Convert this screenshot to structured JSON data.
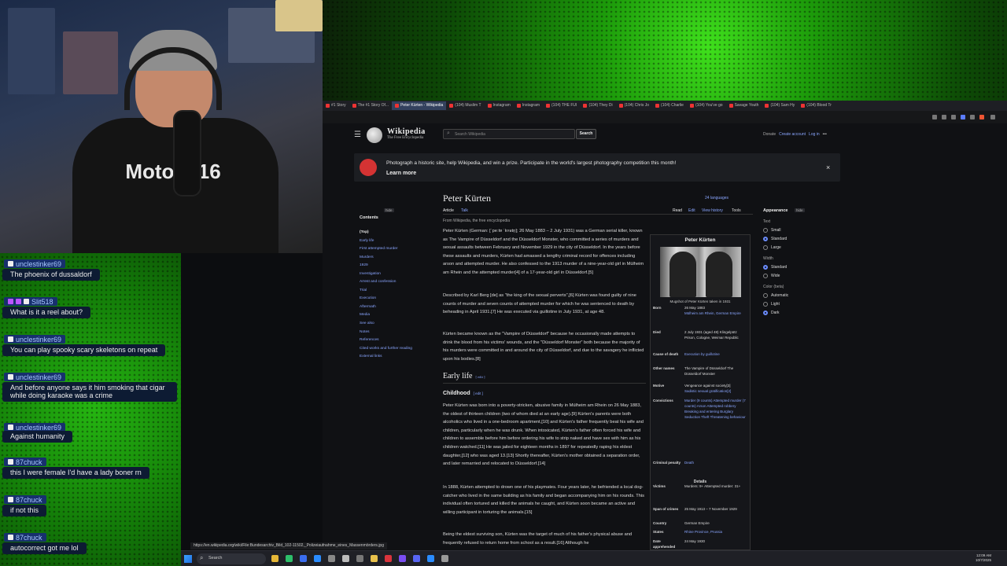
{
  "browser": {
    "tabs": [
      {
        "label": "#1 Story",
        "active": false
      },
      {
        "label": "The #1 Story Of...",
        "active": false
      },
      {
        "label": "Peter Kürten - Wikipedia",
        "active": true
      },
      {
        "label": "(104) Muslim T",
        "active": false
      },
      {
        "label": "Instagram",
        "active": false
      },
      {
        "label": "Instagram",
        "active": false
      },
      {
        "label": "(104) THE FUI",
        "active": false
      },
      {
        "label": "(104) They Di",
        "active": false
      },
      {
        "label": "(104) Chris Jo",
        "active": false
      },
      {
        "label": "(104) Charlie",
        "active": false
      },
      {
        "label": "(104) You've go",
        "active": false
      },
      {
        "label": "Savage Youth",
        "active": false
      },
      {
        "label": "(104) Sam Hy",
        "active": false
      },
      {
        "label": "(104) Blood Tr",
        "active": false
      }
    ],
    "status_url": "https://en.wikipedia.org/wiki/File:Bundesarchiv_Bild_102-11502,_Polizeiaufnahme_eines_Massenmörders.jpg"
  },
  "wikipedia": {
    "wordmark": "Wikipedia",
    "tagline": "The Free Encyclopedia",
    "search_placeholder": "Search Wikipedia",
    "search_button": "Search",
    "user_links": [
      "Donate",
      "Create account",
      "Log in",
      "•••"
    ],
    "banner": {
      "text": "Photograph a historic site, help Wikipedia, and win a prize. Participate in the world's largest photography competition this month!",
      "learn_more": "Learn more",
      "close": "×"
    },
    "toc": {
      "title": "Contents",
      "hide": "hide",
      "items": [
        "(Top)",
        "Early life",
        "First attempted murder",
        "Murders",
        "1929",
        "Investigation",
        "Arrest and confession",
        "Trial",
        "Execution",
        "Aftermath",
        "Media",
        "See also",
        "Notes",
        "References",
        "Cited works and further reading",
        "External links"
      ]
    },
    "article": {
      "title": "Peter Kürten",
      "languages": "24 languages",
      "tabs": {
        "article": "Article",
        "talk": "Talk",
        "read": "Read",
        "edit": "Edit",
        "history": "View history",
        "tools": "Tools"
      },
      "from": "From Wikipedia, the free encyclopedia",
      "p1": "Peter Kürten (German: [ˈpeːtɐ ˈkʏʁtn̩]; 26 May 1883 – 2 July 1931) was a German serial killer, known as The Vampire of Düsseldorf and the Düsseldorf Monster, who committed a series of murders and sexual assaults between February and November 1929 in the city of Düsseldorf. In the years before these assaults and murders, Kürten had amassed a lengthy criminal record for offences including arson and attempted murder. He also confessed to the 1913 murder of a nine-year-old girl in Mülheim am Rhein and the attempted murder[4] of a 17-year-old girl in Düsseldorf.[5]",
      "p2": "Described by Karl Berg [de] as \"the king of the sexual perverts\",[6] Kürten was found guilty of nine counts of murder and seven counts of attempted murder for which he was sentenced to death by beheading in April 1931.[7] He was executed via guillotine in July 1931, at age 48.",
      "p3": "Kürten became known as the \"Vampire of Düsseldorf\" because he occasionally made attempts to drink the blood from his victims' wounds, and the \"Düsseldorf Monster\" both because the majority of his murders were committed in and around the city of Düsseldorf, and due to the savagery he inflicted upon his bodies.[8]",
      "h_early": "Early life",
      "h_child": "Childhood",
      "edit": "[ edit ]",
      "p4": "Peter Kürten was born into a poverty-stricken, abusive family in Mülheim am Rhein on 26 May 1883, the oldest of thirteen children (two of whom died at an early age).[9] Kürten's parents were both alcoholics who lived in a one-bedroom apartment,[10] and Kürten's father frequently beat his wife and children, particularly when he was drunk. When intoxicated, Kürten's father often forced his wife and children to assemble before him before ordering his wife to strip naked and have sex with him as his children watched.[11] He was jailed for eighteen months in 1897 for repeatedly raping his eldest daughter,[12] who was aged 13.[13] Shortly thereafter, Kürten's mother obtained a separation order, and later remarried and relocated to Düsseldorf.[14]",
      "p5": "In 1888, Kürten attempted to drown one of his playmates. Four years later, he befriended a local dog-catcher who lived in the same building as his family and began accompanying him on his rounds. This individual often tortured and killed the animals he caught, and Kürten soon became an active and willing participant in torturing the animals.[15]",
      "p6": "Being the eldest surviving son, Kürten was the target of much of his father's physical abuse and frequently refused to return home from school as a result.[16] Although he"
    },
    "infobox": {
      "title": "Peter Kürten",
      "caption": "Mugshot of Peter Kürten taken in 1931",
      "rows": [
        {
          "label": "Born",
          "value": "26 May 1883",
          "link": "Mülheim am Rhein, German Empire"
        },
        {
          "label": "Died",
          "value": "2 July 1931 (aged 48) Klingelpütz Prison, Cologne, Weimar Republic",
          "link": ""
        },
        {
          "label": "Cause of death",
          "value": "",
          "link": "Execution by guillotine"
        },
        {
          "label": "Other names",
          "value": "The Vampire of Düsseldorf The Düsseldorf Monster",
          "link": ""
        },
        {
          "label": "Motive",
          "value": "Vengeance against society[3]",
          "link": "Sadistic sexual gratification[2]"
        },
        {
          "label": "Convictions",
          "value": "",
          "link": "Murder (9 counts) Attempted murder (7 counts) Arson Attempted robbery Breaking and entering Burglary Seduction Theft Threatening behaviour"
        },
        {
          "label": "Criminal penalty",
          "value": "",
          "link": "Death"
        },
        {
          "label": "Victims",
          "value": "Murders: 9+ Attempted murder: 31+",
          "link": ""
        },
        {
          "label": "Span of crimes",
          "value": "25 May 1913 – 7 November 1929",
          "link": ""
        },
        {
          "label": "Country",
          "value": "German Empire",
          "link": ""
        },
        {
          "label": "States",
          "value": "",
          "link": "Rhine Province, Prussia"
        },
        {
          "label": "Date apprehended",
          "value": "24 May 1930",
          "link": ""
        }
      ],
      "details": "Details"
    },
    "appearance": {
      "title": "Appearance",
      "hide": "hide",
      "text_label": "Text",
      "text_options": [
        "Small",
        "Standard",
        "Large"
      ],
      "text_selected": 1,
      "width_label": "Width",
      "width_options": [
        "Standard",
        "Wide"
      ],
      "width_selected": 0,
      "color_label": "Color (beta)",
      "color_options": [
        "Automatic",
        "Light",
        "Dark"
      ],
      "color_selected": 2
    }
  },
  "webcam": {
    "shirt_text": "Moto 3:16"
  },
  "chat": [
    {
      "user": "unclestinker69",
      "message": "The phoenix of dussaldorf"
    },
    {
      "user": "Slit518",
      "message": "What is it a reel about?"
    },
    {
      "user": "unclestinker69",
      "message": "You can play spooky scary skeletons on repeat"
    },
    {
      "user": "unclestinker69",
      "message": "And before anyone says it him smoking that cigar while doing karaoke was a crime"
    },
    {
      "user": "unclestinker69",
      "message": "Against humanity"
    },
    {
      "user": "87chuck",
      "message": "this I were female I'd have a lady boner rn"
    },
    {
      "user": "87chuck",
      "message": "if not this"
    },
    {
      "user": "87chuck",
      "message": "autocorrect got me lol"
    }
  ],
  "taskbar": {
    "search": "Search",
    "time": "12:09 AM",
    "date": "10/7/2025"
  }
}
